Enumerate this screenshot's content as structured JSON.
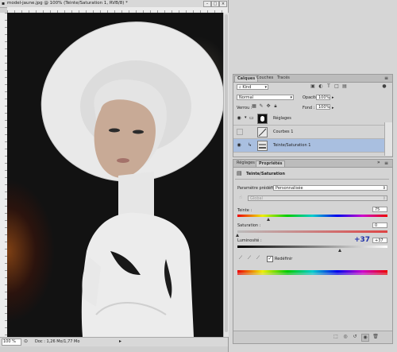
{
  "document": {
    "title": "model-jaune.jpg @ 100% (Teinte/Saturation 1, RVB/8) *",
    "zoom": "100 %",
    "doc_info": "Doc : 1,26 Mo/1,77 Mo"
  },
  "layers_panel": {
    "tabs": [
      "Calques",
      "Couches",
      "Tracés"
    ],
    "kind_filter": "Kind",
    "blend_mode": "Normal",
    "opacity_label": "Opacité :",
    "opacity_value": "100%",
    "lock_label": "Verrou :",
    "fill_label": "Fond :",
    "fill_value": "100%",
    "layers": [
      {
        "name": "Réglages",
        "visible": true,
        "selected": false
      },
      {
        "name": "Courbes 1",
        "visible": false,
        "selected": false
      },
      {
        "name": "Teinte/Saturation 1",
        "visible": true,
        "selected": true
      }
    ]
  },
  "properties_panel": {
    "tabs": [
      "Réglages",
      "Propriétés"
    ],
    "adjustment_title": "Teinte/Saturation",
    "preset_label": "Paramètre prédéfini :",
    "preset_value": "Personnalisée",
    "channel_value": "Global",
    "hue_label": "Teinte :",
    "hue_value": "75",
    "saturation_label": "Saturation :",
    "saturation_value": "0",
    "lightness_label": "Luminosité :",
    "lightness_value": "+37",
    "lightness_overlay": "+37",
    "colorize_label": "Redéfinir",
    "colorize_checked": true
  },
  "colors": {
    "selection": "#a9bfe0",
    "overlay_blue": "#2233aa",
    "background": "#121212"
  }
}
